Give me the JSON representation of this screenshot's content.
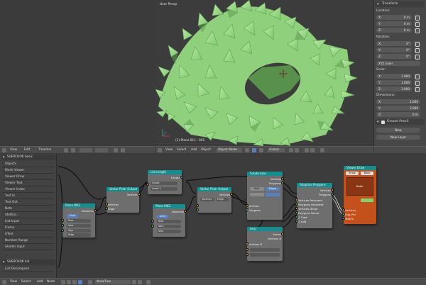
{
  "viewport": {
    "label": "User Persp",
    "object_label": "(1) Plane.011 : 001",
    "header_menus": [
      "View",
      "Select",
      "Add",
      "Object"
    ],
    "mode": "Object Mode",
    "global": "Global"
  },
  "left_area": {
    "header_menus": [
      "View",
      "Edit",
      "Timeline"
    ]
  },
  "properties": {
    "transform_title": "Transform",
    "location_title": "Location:",
    "location": [
      {
        "axis": "X:",
        "value": "0 m"
      },
      {
        "axis": "Y:",
        "value": "0 m"
      },
      {
        "axis": "Z:",
        "value": "0 m"
      }
    ],
    "rotation_title": "Rotation:",
    "rotation": [
      {
        "axis": "X:",
        "value": "0°"
      },
      {
        "axis": "Y:",
        "value": "0°"
      },
      {
        "axis": "Z:",
        "value": "0°"
      }
    ],
    "mode_title": "XYZ Euler",
    "scale_title": "Scale:",
    "scale": [
      {
        "axis": "X:",
        "value": "1.000"
      },
      {
        "axis": "Y:",
        "value": "1.000"
      },
      {
        "axis": "Z:",
        "value": "1.000"
      }
    ],
    "dimensions_title": "Dimensions:",
    "dimensions": [
      {
        "axis": "X:",
        "value": "2.000"
      },
      {
        "axis": "Y:",
        "value": "2.000"
      },
      {
        "axis": "Z:",
        "value": "0 m"
      }
    ],
    "grease_title": "Grease Pencil",
    "grease_new": "New",
    "grease_layer": "New Layer"
  },
  "sidebar": {
    "panel_title": "SVERCHOK basic",
    "items": [
      "Objects",
      "Mesh Viewer",
      "Viewer Draw",
      "Viewer Text",
      "Viewer Index",
      "Text In",
      "Text Out",
      "Note",
      "Stethos..",
      "List Input",
      "Frame",
      "GText",
      "Number Range",
      "Shader Input"
    ],
    "panel2_title": "SVERCHOK list",
    "item_list": "List Decompose"
  },
  "node_editor": {
    "header_menus": [
      "View",
      "Select",
      "Add",
      "Node"
    ],
    "tree_name": "NodeTree"
  },
  "nodes": {
    "plane1": {
      "title": "Plane MK2",
      "rows": [
        "Divisions",
        "Size",
        "Vert.",
        "Sep",
        "Step"
      ],
      "btn": "Cent"
    },
    "plane2": {
      "title": "Plane MK2",
      "rows": [
        "Divisions",
        "Size",
        "Vert.",
        "Sep",
        "Step"
      ],
      "btn": "Cent"
    },
    "scale1": {
      "title": "Vector Polar Output",
      "rows": [
        "Vertices",
        "Edge"
      ],
      "out": "Vertices"
    },
    "listlen": {
      "title": "List Length",
      "rows": [
        "Count",
        "Level 1"
      ],
      "out": "Length"
    },
    "scale2": {
      "title": "Vector Polar Output",
      "rows": [
        "Vertices",
        "Edge"
      ],
      "out": "Vertices"
    },
    "subdiv": {
      "title": "Subdivision",
      "rows": [
        "Vertices",
        "Polygons"
      ],
      "btns": [
        "Vert.",
        "Edges"
      ],
      "rows2": [
        "Vertices",
        "Polygons"
      ]
    },
    "apply": {
      "title": "Adaptive Polygons",
      "rows": [
        "Vertices Recipient",
        "Polygons Recipient",
        "Vertices Donor",
        "Polygons Donor",
        "Z Coef",
        "Z Add"
      ],
      "out": [
        "Vertices",
        "Polygons"
      ]
    },
    "lerp": {
      "title": "Lerp",
      "rows": [
        "Factor",
        "Vertices A",
        "Vertices B"
      ]
    },
    "viewer": {
      "title": "Viewer Draw",
      "rows": [
        "Show",
        "Bake"
      ],
      "mid": "Bake",
      "ver": "Vertices",
      "edg": "Edg_Pol",
      "mat": "Matrix",
      "color": "#c4511c"
    }
  },
  "colors": {
    "node_header": "#148f8f",
    "mesh_green": "#9ad98a",
    "viewer_body": "#c4511c"
  }
}
